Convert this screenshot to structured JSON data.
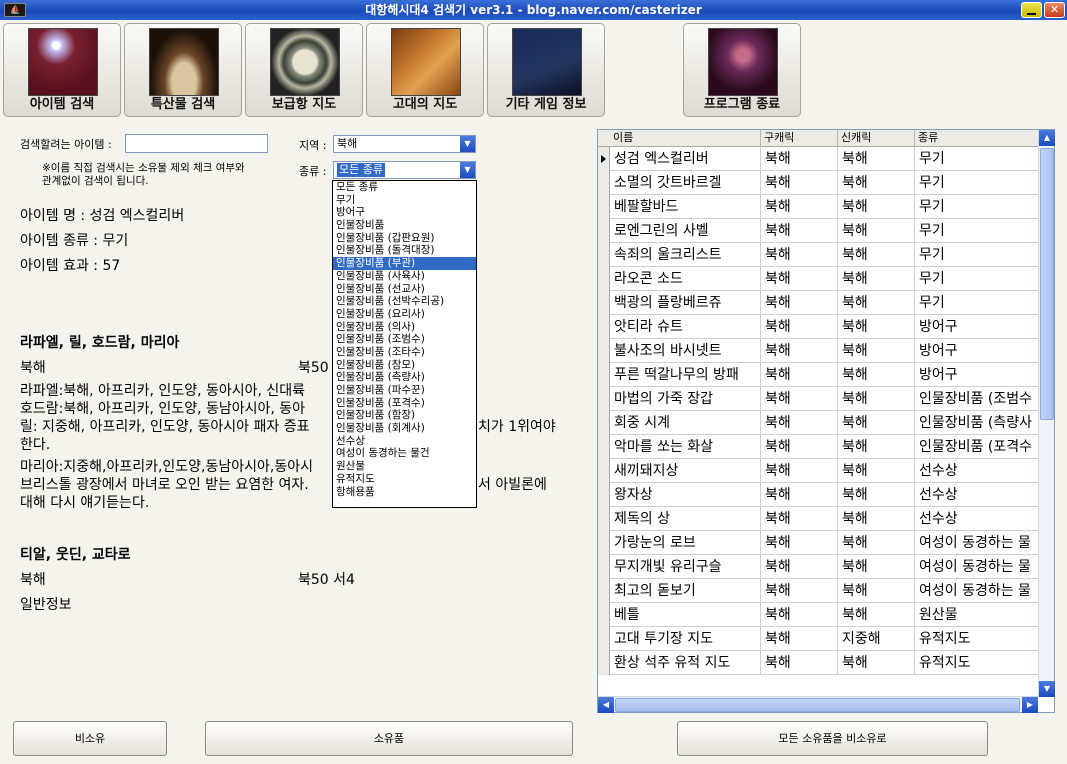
{
  "window": {
    "title": "대항해시대4 검색기 ver3.1 - blog.naver.com/casterizer",
    "icon": "ship-icon"
  },
  "toolbar": {
    "buttons": [
      {
        "label": "아이템 검색",
        "icon": "magic-wand-icon"
      },
      {
        "label": "특산물 검색",
        "icon": "spice-jar-icon"
      },
      {
        "label": "보급항 지도",
        "icon": "compass-icon"
      },
      {
        "label": "고대의 지도",
        "icon": "old-map-icon"
      },
      {
        "label": "기타 게임 정보",
        "icon": "book-icon"
      },
      {
        "label": "프로그램 종료",
        "icon": "devil-icon"
      }
    ]
  },
  "search": {
    "item_label": "검색할려는 아이템 :",
    "item_value": "",
    "note_line1": "※이름 직접 검색시는 소유물 제외 체크 여부와",
    "note_line2": "관계없이 검색이 됩니다.",
    "region_label": "지역 :",
    "region_value": "북해",
    "type_label": "종류 :",
    "type_value": "모든 종류"
  },
  "dropdown": {
    "items": [
      "모든 종류",
      "무기",
      "방어구",
      "인물장비품",
      "인물장비품 (갑판요원)",
      "인물장비품 (돌격대장)",
      "인물장비품 (부관)",
      "인물장비품 (사육사)",
      "인물장비품 (선교사)",
      "인물장비품 (선박수리공)",
      "인물장비품 (요리사)",
      "인물장비품 (의사)",
      "인물장비품 (조범수)",
      "인물장비품 (조타수)",
      "인물장비품 (참모)",
      "인물장비품 (측량사)",
      "인물장비품 (파수꾼)",
      "인물장비품 (포격수)",
      "인물장비품 (함장)",
      "인물장비품 (회계사)",
      "선수상",
      "여성이 동경하는 물건",
      "원산물",
      "유적지도",
      "항해용품"
    ],
    "selected_index": 6
  },
  "item_info": {
    "name": "아이템 명 : 성검 엑스컬리버",
    "type": "아이템 종류 : 무기",
    "effect": "아이템 효과 : 57"
  },
  "section1": {
    "heading": "라파엘, 릴, 호드람, 마리아",
    "region": "북해",
    "coord": "북50",
    "lines": [
      "라파엘:북해, 아프리카, 인도양, 동아시아, 신대륙",
      "호드람:북해, 아프리카, 인도양, 동남아시아, 동아",
      "릴: 지중해, 아프리카, 인도양, 동아시아 패자 증표",
      "한다.",
      "마리아:지중해,아프리카,인도양,동남아시아,동아시",
      "브리스톨 광장에서 마녀로 오인 받는 요염한 여자.",
      "대해 다시 얘기듣는다."
    ],
    "overflow_a": "치가 1위여야",
    "overflow_b": "서 아빌론에"
  },
  "section2": {
    "heading": "티알, 웃딘, 교타로",
    "region": "북해",
    "coord": "북50 서4",
    "info": "일반정보"
  },
  "grid": {
    "headers": [
      "이름",
      "구캐릭",
      "신캐릭",
      "종류"
    ],
    "rows": [
      [
        "성검 엑스컬리버",
        "북해",
        "북해",
        "무기"
      ],
      [
        "소멸의 갓트바르겔",
        "북해",
        "북해",
        "무기"
      ],
      [
        "베팔할바드",
        "북해",
        "북해",
        "무기"
      ],
      [
        "로엔그린의 사벨",
        "북해",
        "북해",
        "무기"
      ],
      [
        "속죄의 울크리스트",
        "북해",
        "북해",
        "무기"
      ],
      [
        "라오콘 소드",
        "북해",
        "북해",
        "무기"
      ],
      [
        "백광의 플랑베르쥬",
        "북해",
        "북해",
        "무기"
      ],
      [
        "앗티라 슈트",
        "북해",
        "북해",
        "방어구"
      ],
      [
        "불사조의 바시넷트",
        "북해",
        "북해",
        "방어구"
      ],
      [
        "푸른 떡갈나무의 방패",
        "북해",
        "북해",
        "방어구"
      ],
      [
        "마법의 가죽 장갑",
        "북해",
        "북해",
        "인물장비품 (조범수"
      ],
      [
        "회중 시계",
        "북해",
        "북해",
        "인물장비품 (측량사"
      ],
      [
        "악마를 쏘는 화살",
        "북해",
        "북해",
        "인물장비품 (포격수"
      ],
      [
        "새끼돼지상",
        "북해",
        "북해",
        "선수상"
      ],
      [
        "왕자상",
        "북해",
        "북해",
        "선수상"
      ],
      [
        "제독의 상",
        "북해",
        "북해",
        "선수상"
      ],
      [
        "가랑눈의 로브",
        "북해",
        "북해",
        "여성이 동경하는 물"
      ],
      [
        "무지개빛 유리구슬",
        "북해",
        "북해",
        "여성이 동경하는 물"
      ],
      [
        "최고의 돋보기",
        "북해",
        "북해",
        "여성이 동경하는 물"
      ],
      [
        "베틀",
        "북해",
        "북해",
        "원산물"
      ],
      [
        "고대 투기장 지도",
        "북해",
        "지중해",
        "유적지도"
      ],
      [
        "환상 석주 유적 지도",
        "북해",
        "북해",
        "유적지도"
      ]
    ]
  },
  "bottom": {
    "btn1": "비소유",
    "btn2": "소유품",
    "btn3": "모든 소유품을 비소유로"
  }
}
